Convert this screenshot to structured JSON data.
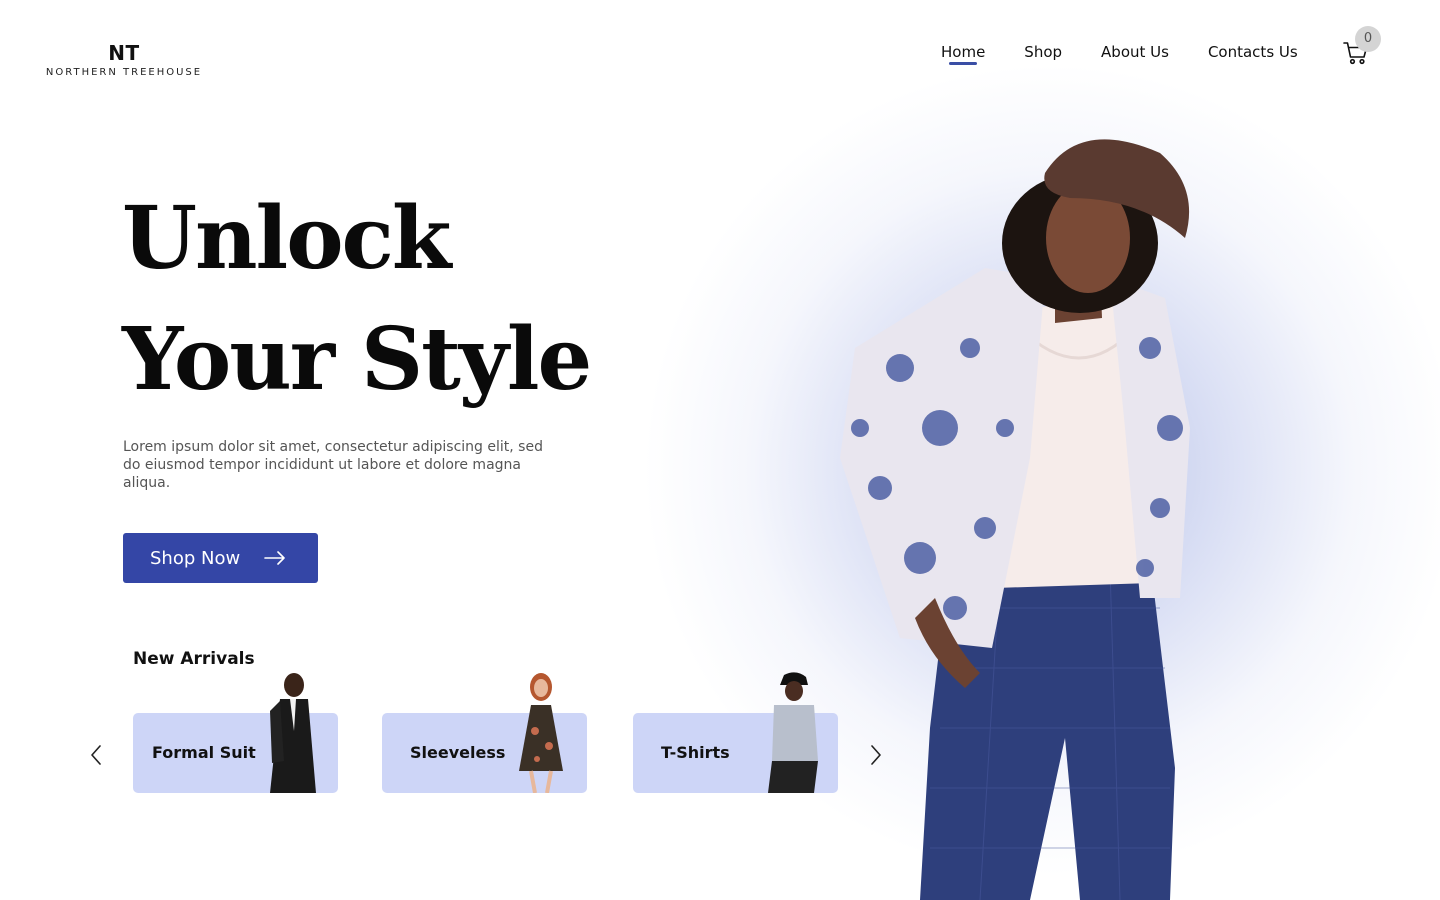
{
  "brand": {
    "mark": "NT",
    "name": "NORTHERN TREEHOUSE"
  },
  "nav": {
    "items": [
      {
        "label": "Home",
        "active": true
      },
      {
        "label": "Shop",
        "active": false
      },
      {
        "label": "About Us",
        "active": false
      },
      {
        "label": "Contacts Us",
        "active": false
      }
    ]
  },
  "cart": {
    "icon": "cart-icon",
    "count": "0"
  },
  "hero": {
    "title_line1": "Unlock",
    "title_line2": "Your Style",
    "description": "Lorem ipsum dolor sit amet, consectetur adipiscing elit, sed do eiusmod tempor incididunt ut labore et dolore magna aliqua.",
    "cta_label": "Shop Now",
    "cta_icon": "arrow-right-icon"
  },
  "arrivals": {
    "title": "New Arrivals",
    "prev_icon": "chevron-left-icon",
    "next_icon": "chevron-right-icon",
    "items": [
      {
        "label": "Formal Suit"
      },
      {
        "label": "Sleeveless"
      },
      {
        "label": "T-Shirts"
      }
    ]
  },
  "colors": {
    "accent": "#3446a6",
    "card_bg": "#cdd5f7",
    "badge_bg": "#d4d4d4"
  }
}
